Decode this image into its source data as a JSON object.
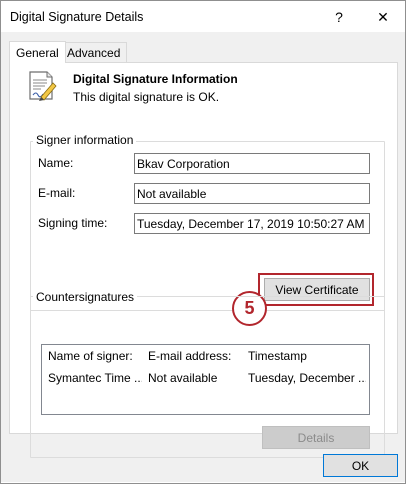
{
  "window": {
    "title": "Digital Signature Details",
    "help_glyph": "?",
    "close_glyph": "✕"
  },
  "tabs": [
    {
      "label": "General",
      "selected": true
    },
    {
      "label": "Advanced",
      "selected": false
    }
  ],
  "info": {
    "icon": "certificate-document-icon",
    "title": "Digital Signature Information",
    "status": "This digital signature is OK."
  },
  "signer": {
    "group_label": "Signer information",
    "name_label": "Name:",
    "name_value": "Bkav Corporation",
    "email_label": "E-mail:",
    "email_value": "Not available",
    "time_label": "Signing time:",
    "time_value": "Tuesday, December  17, 2019 10:50:27 AM",
    "view_cert_label": "View Certificate"
  },
  "annotation": {
    "step_number": "5",
    "accent_color": "#b2262d"
  },
  "countersignatures": {
    "group_label": "Countersignatures",
    "columns": [
      "Name of signer:",
      "E-mail address:",
      "Timestamp"
    ],
    "rows": [
      [
        "Symantec Time ...",
        "Not available",
        "Tuesday, December ..."
      ]
    ],
    "details_label": "Details"
  },
  "footer": {
    "ok_label": "OK"
  }
}
